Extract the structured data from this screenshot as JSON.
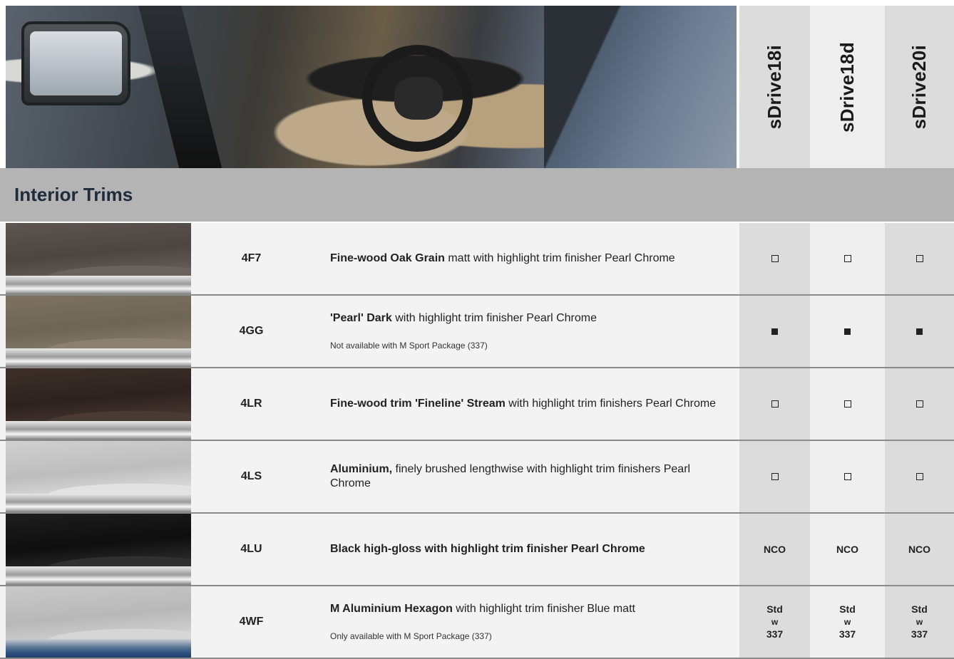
{
  "models": [
    "sDrive18i",
    "sDrive18d",
    "sDrive20i"
  ],
  "section": {
    "title": "Interior Trims"
  },
  "rows": [
    {
      "code": "4F7",
      "name": "Fine-wood Oak Grain",
      "rest": " matt with highlight trim finisher Pearl Chrome",
      "note": "",
      "availability": [
        "optional",
        "optional",
        "optional"
      ],
      "swatch_colors": [
        "#6a625c",
        "#4c4540",
        "#5d5550"
      ]
    },
    {
      "code": "4GG",
      "name": "'Pearl' Dark",
      "rest": " with highlight trim finisher Pearl Chrome",
      "note": "Not available with M Sport Package (337)",
      "availability": [
        "standard",
        "standard",
        "standard"
      ],
      "swatch_colors": [
        "#8b8070",
        "#6e6556",
        "#7d7262"
      ]
    },
    {
      "code": "4LR",
      "name": "Fine-wood trim 'Fineline' Stream",
      "rest": " with highlight trim finishers Pearl Chrome",
      "note": "",
      "availability": [
        "optional",
        "optional",
        "optional"
      ],
      "swatch_colors": [
        "#4a3a34",
        "#2d221e",
        "#3d302a"
      ]
    },
    {
      "code": "4LS",
      "name": "Aluminium,",
      "rest": " finely brushed lengthwise with highlight trim finishers Pearl Chrome",
      "note": "",
      "availability": [
        "optional",
        "optional",
        "optional"
      ],
      "swatch_colors": [
        "#e2e2e2",
        "#bdbdbd",
        "#d0d0d0"
      ]
    },
    {
      "code": "4LU",
      "name": "Black high-gloss with highlight trim finisher Pearl Chrome",
      "rest": "",
      "note": "",
      "availability": [
        "NCO",
        "NCO",
        "NCO"
      ],
      "swatch_colors": [
        "#303030",
        "#0e0e0e",
        "#1e1e1e"
      ]
    },
    {
      "code": "4WF",
      "name": "M Aluminium Hexagon",
      "rest": " with highlight trim finisher Blue matt",
      "note": "Only available with M Sport Package (337)",
      "availability": [
        "Std w 337",
        "Std w 337",
        "Std w 337"
      ],
      "swatch_colors": [
        "#d6d6d6",
        "#b8b8b8",
        "#c9c9c9"
      ]
    }
  ]
}
